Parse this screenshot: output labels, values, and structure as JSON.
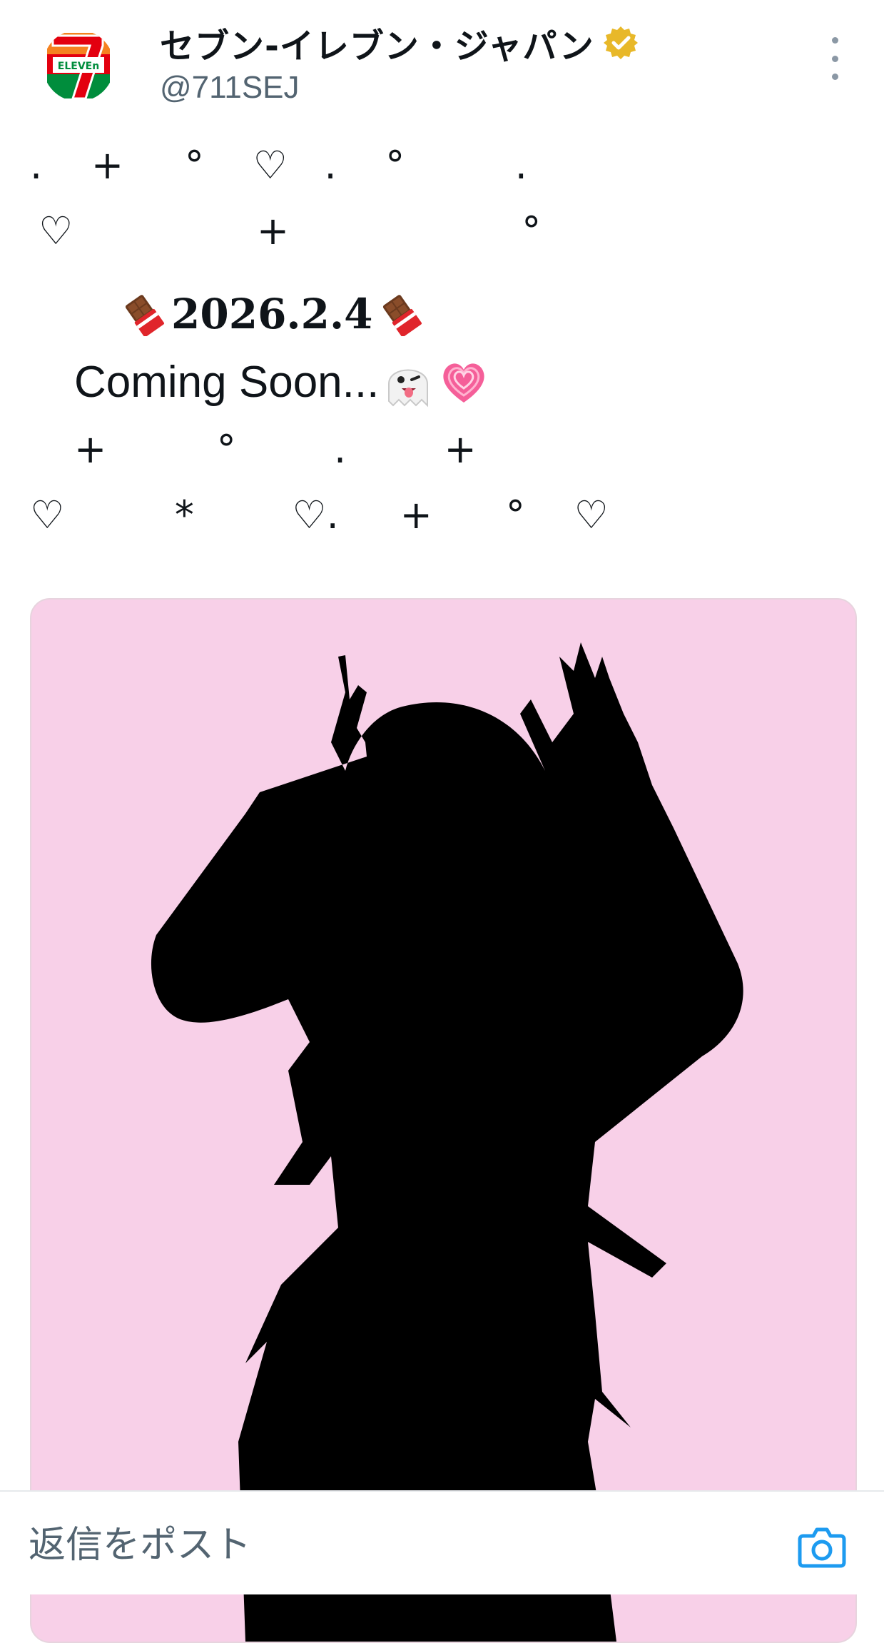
{
  "account": {
    "display_name": "セブン‐イレブン・ジャパン",
    "handle": "@711SEJ",
    "verified_badge": "verified-gold-badge-icon",
    "avatar_icon": "seven-eleven-logo"
  },
  "colors": {
    "brand_green": "#008d3c",
    "brand_orange": "#f58220",
    "brand_red": "#e3000f",
    "verified_gold": "#e8b829",
    "media_background": "#f8d0e8",
    "accent_blue": "#1d9bf0"
  },
  "post": {
    "deco_line_1": ".    +     °    ♡   .    °         .",
    "deco_line_2": "♡               +                   °",
    "date_text": "2026.2.4",
    "date_emoji": "chocolate-bar-icon",
    "coming_text": "Coming Soon...",
    "coming_emojis": [
      "ghost-icon",
      "growing-heart-icon"
    ],
    "deco_line_3": "+         °        .        +",
    "deco_line_4": "♡         *        ♡.     +      °    ♡",
    "media_alt": "character-silhouette-image"
  },
  "reply": {
    "placeholder": "返信をポスト",
    "camera_icon": "camera-icon"
  }
}
